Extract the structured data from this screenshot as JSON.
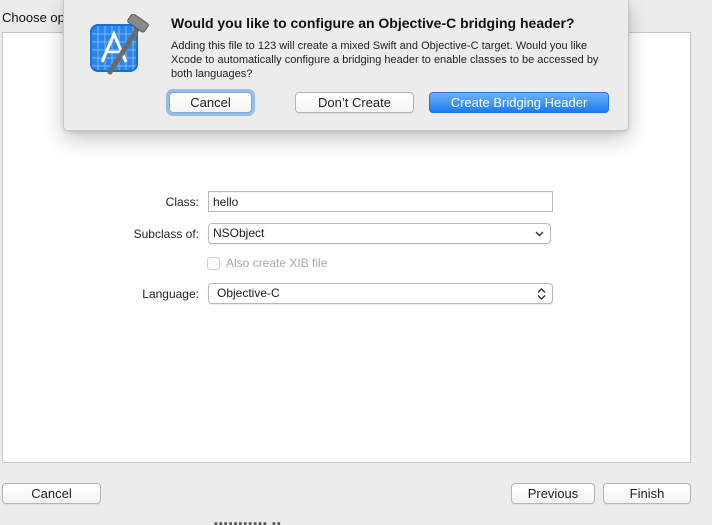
{
  "sheet": {
    "header_text": "Choose op",
    "form": {
      "class_label": "Class:",
      "class_value": "hello",
      "subclass_label": "Subclass of:",
      "subclass_value": "NSObject",
      "xib_checkbox_label": "Also create XIB file",
      "xib_checked": false,
      "language_label": "Language:",
      "language_value": "Objective-C"
    },
    "buttons": {
      "cancel": "Cancel",
      "previous": "Previous",
      "finish": "Finish"
    }
  },
  "alert": {
    "icon": "xcode-hammer-icon",
    "title": "Would you like to configure an Objective-C bridging header?",
    "message": "Adding this file to 123 will create a mixed Swift and Objective-C target. Would you like Xcode to automatically configure a bridging header to enable classes to be accessed by both languages?",
    "buttons": {
      "cancel": "Cancel",
      "dont_create": "Don’t Create",
      "create": "Create Bridging Header"
    }
  },
  "colors": {
    "window_bg": "#ececec",
    "panel_bg": "#ffffff",
    "primary_button": "#1c7cf0",
    "focus_ring": "#5096e6"
  }
}
